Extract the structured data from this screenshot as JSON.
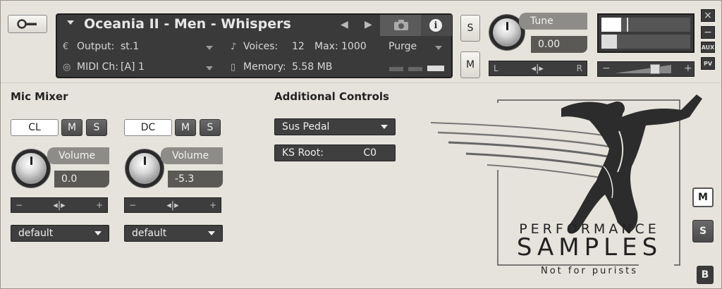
{
  "header": {
    "instrument_name": "Oceania II - Men - Whispers",
    "output_label": "Output:",
    "output_value": "st.1",
    "midi_label": "MIDI Ch:",
    "midi_value": "[A]  1",
    "voices_label": "Voices:",
    "voices_value": "12",
    "max_label": "Max:",
    "max_value": "1000",
    "memory_label": "Memory:",
    "memory_value": "5.58 MB",
    "purge_label": "Purge",
    "solo_label": "S",
    "mute_label": "M",
    "tune_label": "Tune",
    "tune_value": "0.00",
    "pan_left": "L",
    "pan_right": "R",
    "aux_label": "AUX",
    "pv_label": "PV"
  },
  "mic_mixer": {
    "title": "Mic Mixer",
    "channels": [
      {
        "name": "CL",
        "mute": "M",
        "solo": "S",
        "volume_label": "Volume",
        "volume_value": "0.0",
        "preset": "default"
      },
      {
        "name": "DC",
        "mute": "M",
        "solo": "S",
        "volume_label": "Volume",
        "volume_value": "-5.3",
        "preset": "default"
      }
    ]
  },
  "additional_controls": {
    "title": "Additional Controls",
    "sus_pedal": "Sus Pedal",
    "ks_root_label": "KS Root:",
    "ks_root_value": "C0"
  },
  "logo": {
    "line1": "PERFORMANCE",
    "line2": "SAMPLES",
    "tagline": "Not for purists"
  },
  "side_buttons": {
    "m": "M",
    "s": "S",
    "b": "B"
  }
}
